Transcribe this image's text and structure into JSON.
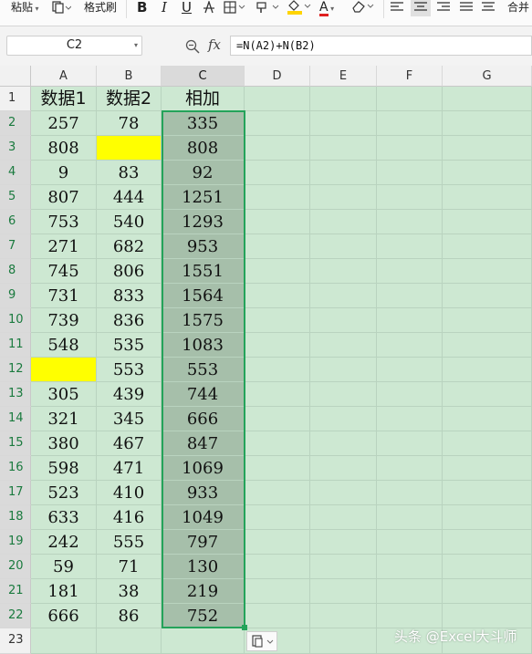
{
  "toolbar": {
    "paste_label": "粘贴",
    "format_painter_label": "格式刷",
    "bold_label": "B",
    "italic_label": "I",
    "underline_label": "U",
    "font_color_label": "A",
    "merge_label": "合并"
  },
  "formula_bar": {
    "cell_ref": "C2",
    "fx_label": "fx",
    "formula": "=N(A2)+N(B2)"
  },
  "columns": [
    "A",
    "B",
    "C",
    "D",
    "E",
    "F",
    "G"
  ],
  "rows": [
    "1",
    "2",
    "3",
    "4",
    "5",
    "6",
    "7",
    "8",
    "9",
    "10",
    "11",
    "12",
    "13",
    "14",
    "15",
    "16",
    "17",
    "18",
    "19",
    "20",
    "21",
    "22",
    "23"
  ],
  "table": {
    "headers": [
      "数据1",
      "数据2",
      "相加"
    ],
    "data": [
      [
        "257",
        "78",
        "335"
      ],
      [
        "808",
        "",
        "808"
      ],
      [
        "9",
        "83",
        "92"
      ],
      [
        "807",
        "444",
        "1251"
      ],
      [
        "753",
        "540",
        "1293"
      ],
      [
        "271",
        "682",
        "953"
      ],
      [
        "745",
        "806",
        "1551"
      ],
      [
        "731",
        "833",
        "1564"
      ],
      [
        "739",
        "836",
        "1575"
      ],
      [
        "548",
        "535",
        "1083"
      ],
      [
        "",
        "553",
        "553"
      ],
      [
        "305",
        "439",
        "744"
      ],
      [
        "321",
        "345",
        "666"
      ],
      [
        "380",
        "467",
        "847"
      ],
      [
        "598",
        "471",
        "1069"
      ],
      [
        "523",
        "410",
        "933"
      ],
      [
        "633",
        "416",
        "1049"
      ],
      [
        "242",
        "555",
        "797"
      ],
      [
        "59",
        "71",
        "130"
      ],
      [
        "181",
        "38",
        "219"
      ],
      [
        "666",
        "86",
        "752"
      ]
    ]
  },
  "colors": {
    "sheet_bg": "#cde8d2",
    "selection_fill": "#a6bfaa",
    "selection_border": "#24a35a",
    "highlight": "#ffff00"
  },
  "watermark": "头条 @Excel大斗师"
}
